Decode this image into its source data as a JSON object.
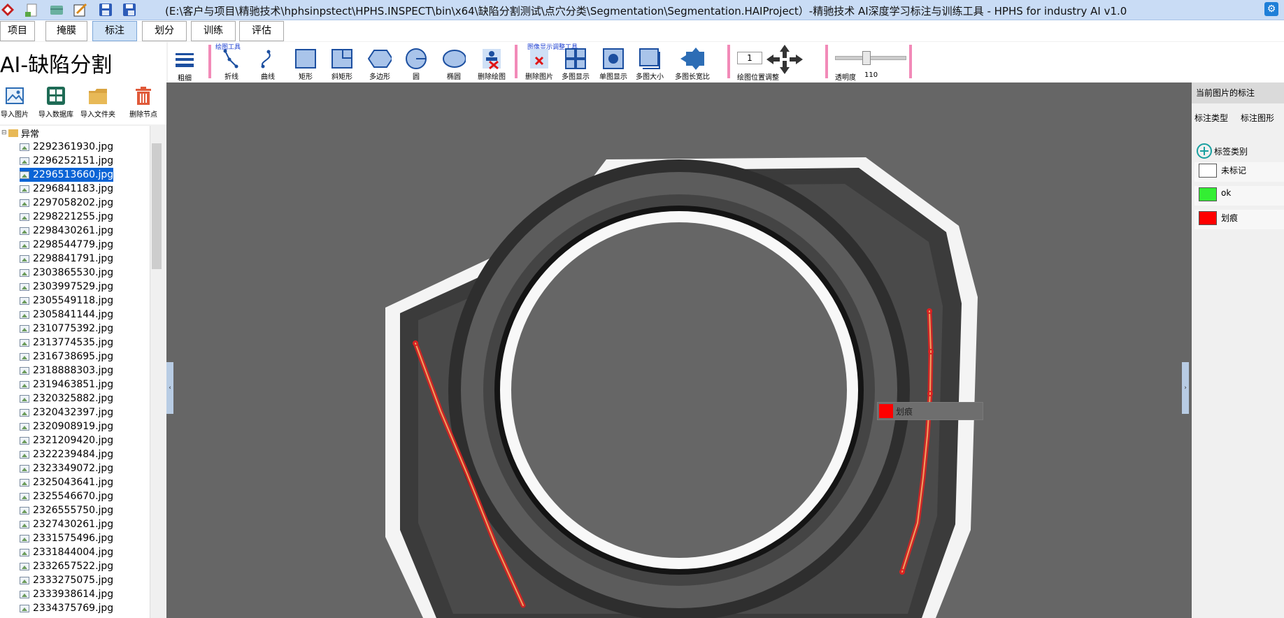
{
  "window": {
    "title": "(E:\\客户与项目\\精驰技术\\hphsinpstect\\HPHS.INSPECT\\bin\\x64\\缺陷分割测试\\点穴分类\\Segmentation\\Segmentation.HAIProject）-精驰技术 AI深度学习标注与训练工具 - HPHS for industry AI v1.0"
  },
  "menu": {
    "tabs": [
      {
        "label": "项目"
      },
      {
        "label": "掩膜"
      },
      {
        "label": "标注"
      },
      {
        "label": "划分"
      },
      {
        "label": "训练"
      },
      {
        "label": "评估"
      }
    ],
    "active_tab": "标注"
  },
  "left_ribbon": {
    "app_title": "AI-缺陷分割",
    "buttons": [
      {
        "label": "导入图片",
        "icon": "import-image-icon"
      },
      {
        "label": "导入数据库",
        "icon": "import-database-icon"
      },
      {
        "label": "导入文件夹",
        "icon": "import-folder-icon"
      },
      {
        "label": "删除节点",
        "icon": "trash-icon"
      }
    ]
  },
  "toolbar": {
    "thickness_label": "粗细",
    "drawing_group_label": "绘图工具",
    "display_group_label": "图像显示调整工具",
    "draw_tools": [
      {
        "label": "折线",
        "icon": "polyline-icon"
      },
      {
        "label": "曲线",
        "icon": "curve-icon"
      },
      {
        "label": "矩形",
        "icon": "rectangle-icon"
      },
      {
        "label": "斜矩形",
        "icon": "rotated-rectangle-icon"
      },
      {
        "label": "多边形",
        "icon": "polygon-icon"
      },
      {
        "label": "圆",
        "icon": "circle-icon"
      },
      {
        "label": "椭圆",
        "icon": "ellipse-icon"
      },
      {
        "label": "删除绘图",
        "icon": "delete-drawing-icon"
      }
    ],
    "display_tools": [
      {
        "label": "删除图片",
        "icon": "delete-image-icon"
      },
      {
        "label": "多图显示",
        "icon": "multi-view-icon"
      },
      {
        "label": "单图显示",
        "icon": "single-view-icon"
      },
      {
        "label": "多图大小",
        "icon": "multi-size-icon"
      },
      {
        "label": "多图长宽比",
        "icon": "aspect-ratio-icon"
      }
    ],
    "position_value": "1",
    "position_label": "绘图位置调整",
    "opacity_label": "透明度",
    "opacity_value": "110",
    "opacity_fraction": 0.43
  },
  "tree": {
    "root_label": "异常",
    "selected_index": 2,
    "items": [
      "2292361930.jpg",
      "2296252151.jpg",
      "2296513660.jpg",
      "2296841183.jpg",
      "2297058202.jpg",
      "2298221255.jpg",
      "2298430261.jpg",
      "2298544779.jpg",
      "2298841791.jpg",
      "2303865530.jpg",
      "2303997529.jpg",
      "2305549118.jpg",
      "2305841144.jpg",
      "2310775392.jpg",
      "2313774535.jpg",
      "2316738695.jpg",
      "2318888303.jpg",
      "2319463851.jpg",
      "2320325882.jpg",
      "2320432397.jpg",
      "2320908919.jpg",
      "2321209420.jpg",
      "2322239484.jpg",
      "2323349072.jpg",
      "2325043641.jpg",
      "2325546670.jpg",
      "2326555750.jpg",
      "2327430261.jpg",
      "2331575496.jpg",
      "2331844004.jpg",
      "2332657522.jpg",
      "2333275075.jpg",
      "2333938614.jpg",
      "2334375769.jpg"
    ]
  },
  "canvas": {
    "annotation_tooltip_label": "划痕",
    "annotation_color": "#ff0000"
  },
  "right_panel": {
    "header": "当前图片的标注",
    "tab_type": "标注类型",
    "tab_shape": "标注图形",
    "add_category": "标签类别",
    "labels": [
      {
        "name": "未标记",
        "color": "#ffffff"
      },
      {
        "name": "ok",
        "color": "#33ee33"
      },
      {
        "name": "划痕",
        "color": "#ff0000"
      }
    ]
  },
  "colors": {
    "accent": "#0a64d6",
    "titlebar": "#c9dcf5",
    "separator": "#f28ab8",
    "canvas_bg": "#666666"
  }
}
